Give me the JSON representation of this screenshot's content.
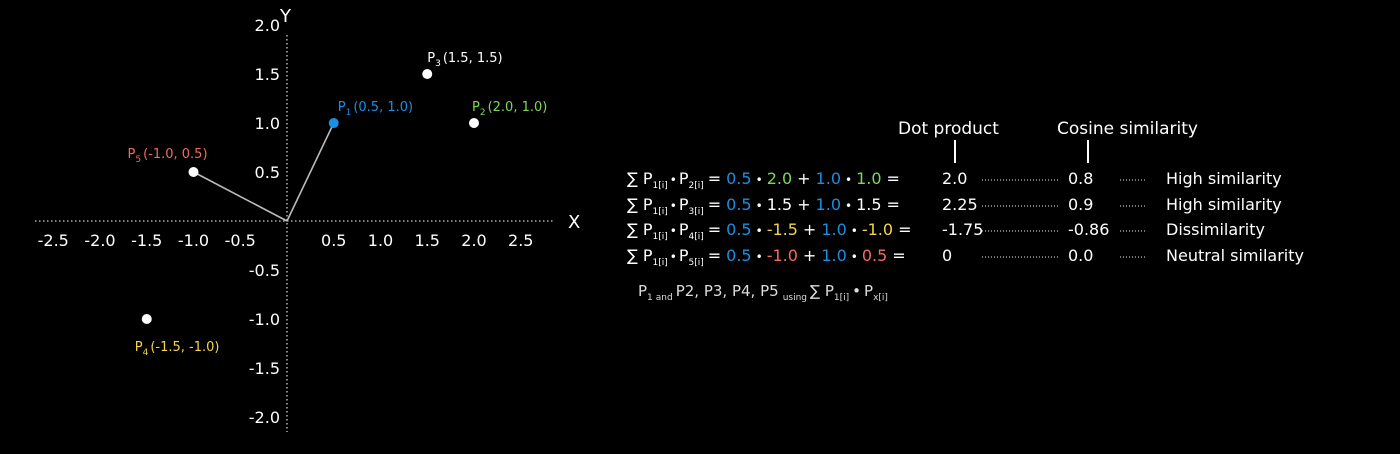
{
  "axis": {
    "x_label": "X",
    "y_label": "Y"
  },
  "x_ticks": [
    "-2.5",
    "-2.0",
    "-1.5",
    "-1.0",
    "-0.5",
    "0.5",
    "1.0",
    "1.5",
    "2.0",
    "2.5"
  ],
  "y_ticks": [
    "2.0",
    "1.5",
    "1.0",
    "0.5",
    "-0.5",
    "-1.0",
    "-1.5",
    "-2.0"
  ],
  "points": [
    {
      "name": "P",
      "sub": "1",
      "coords": "(0.5, 1.0)",
      "x": 0.5,
      "y": 1.0,
      "color": "#1a8fe3"
    },
    {
      "name": "P",
      "sub": "2",
      "coords": "(2.0, 1.0)",
      "x": 2.0,
      "y": 1.0,
      "color": "#7ed957"
    },
    {
      "name": "P",
      "sub": "3",
      "coords": "(1.5, 1.5)",
      "x": 1.5,
      "y": 1.5,
      "color": "#ffffff"
    },
    {
      "name": "P",
      "sub": "4",
      "coords": "(-1.5, -1.0)",
      "x": -1.5,
      "y": -1.0,
      "color": "#f5d547"
    },
    {
      "name": "P",
      "sub": "5",
      "coords": "(-1.0, 0.5)",
      "x": -1.0,
      "y": 0.5,
      "color": "#f26b5b"
    }
  ],
  "colors": {
    "p1": "#1a8fe3",
    "p2": "#7ed957",
    "p3": "#ffffff",
    "p4": "#f5d547",
    "p5": "#f26b5b",
    "vector_line": "#bbbbbb",
    "dot_p1": "#1a8fe3"
  },
  "headers": {
    "dot_product": "Dot product",
    "cosine": "Cosine similarity"
  },
  "equations": [
    {
      "lhs": "P2",
      "lhs_sub": "2[i]",
      "a1": "0.5",
      "b1": "2.0",
      "a2": "1.0",
      "b2": "1.0",
      "b_color": "#7ed957",
      "dot": "2.0",
      "cos": "0.8",
      "label": "High similarity"
    },
    {
      "lhs": "P3",
      "lhs_sub": "3[i]",
      "a1": "0.5",
      "b1": "1.5",
      "a2": "1.0",
      "b2": "1.5",
      "b_color": "#ffffff",
      "dot": "2.25",
      "cos": "0.9",
      "label": "High similarity"
    },
    {
      "lhs": "P4",
      "lhs_sub": "4[i]",
      "a1": "0.5",
      "b1": "-1.5",
      "a2": "1.0",
      "b2": "-1.0",
      "b_color": "#f5d547",
      "dot": "-1.75",
      "cos": "-0.86",
      "label": "Dissimilarity"
    },
    {
      "lhs": "P5",
      "lhs_sub": "5[i]",
      "a1": "0.5",
      "b1": "-1.0",
      "a2": "1.0",
      "b2": "0.5",
      "b_color": "#f26b5b",
      "dot": "0",
      "cos": "0.0",
      "label": "Neutral similarity"
    }
  ],
  "footnote": {
    "p1": "P",
    "p1_sub": "1",
    "and": "and",
    "rest": "P2, P3, P4, P5",
    "using": "using",
    "sum": "∑ P",
    "sum_sub": "1[i]",
    "bullet": "•",
    "px": "P",
    "px_sub": "x[i]"
  }
}
